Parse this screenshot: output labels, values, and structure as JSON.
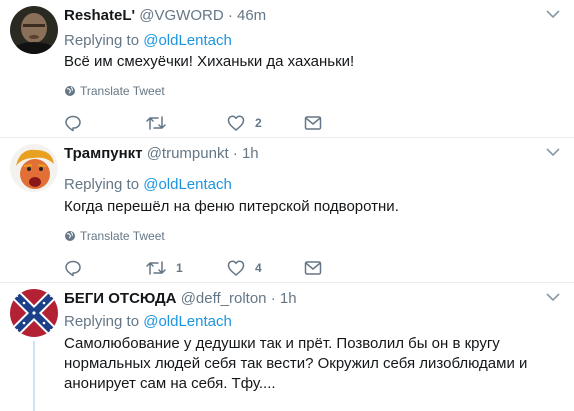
{
  "tweets": [
    {
      "name": "ReshateL'",
      "handle": "@VGWORD",
      "time": "46m",
      "replying_prefix": "Replying to",
      "replying_to": "@oldLentach",
      "text": "Всё им смехуёчки! Хиханьки да хаханьки!",
      "translate_label": "Translate Tweet",
      "counts": {
        "reply": "",
        "retweet": "",
        "like": "2",
        "dm": ""
      }
    },
    {
      "name": "Трампункт",
      "handle": "@trumpunkt",
      "time": "1h",
      "replying_prefix": "Replying to",
      "replying_to": "@oldLentach",
      "text": "Когда перешёл на феню питерской подворотни.",
      "translate_label": "Translate Tweet",
      "counts": {
        "reply": "",
        "retweet": "1",
        "like": "4",
        "dm": ""
      }
    },
    {
      "name": "БЕГИ ОТСЮДА",
      "handle": "@deff_rolton",
      "time": "1h",
      "replying_prefix": "Replying to",
      "replying_to": "@oldLentach",
      "text": "Самолюбование у дедушки так и прёт. Позволил бы он в кругу нормальных людей себя так вести? Окружил себя лизоблюдами и анонирует сам на себя. Тфу...."
    }
  ],
  "separator": "·",
  "colors": {
    "link": "#1b95e0",
    "muted": "#657786",
    "text": "#14171a",
    "border": "#e6ecf0",
    "thread_line": "#cce4f6"
  },
  "icons": [
    "chevron-down-icon",
    "globe-icon",
    "reply-icon",
    "retweet-icon",
    "heart-icon",
    "envelope-icon"
  ]
}
